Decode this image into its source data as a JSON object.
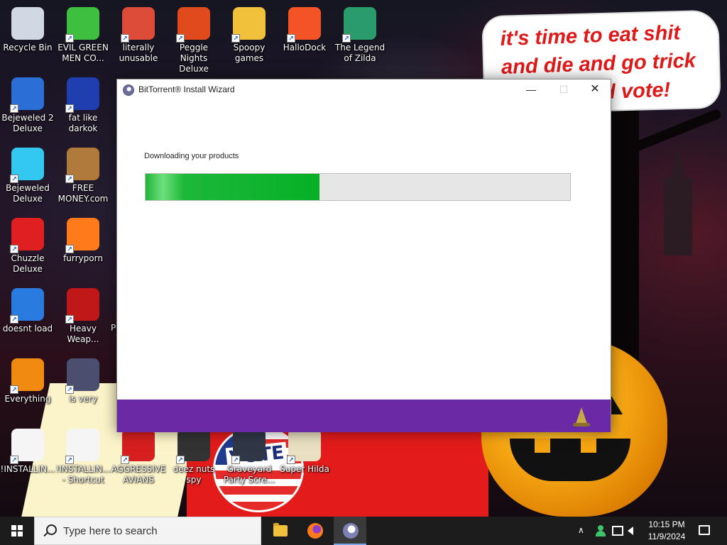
{
  "desktop": {
    "speech_bubble_text": "it's time to eat shit and die and go trick or treat and vote!",
    "badge_text": "VOTE",
    "icons": [
      {
        "label": "Recycle Bin",
        "icon": "recycle-bin-icon",
        "color": "#cfd8e3"
      },
      {
        "label": "EVIL GREEN MEN CO...",
        "icon": "evil-green-men-icon",
        "color": "#3fbf3f"
      },
      {
        "label": "literally unusable",
        "icon": "chrome-icon",
        "color": "#dd4b39"
      },
      {
        "label": "Peggle Nights Deluxe",
        "icon": "peggle-icon",
        "color": "#e04a1d"
      },
      {
        "label": "Spoopy games",
        "icon": "folder-icon",
        "color": "#f2c13b"
      },
      {
        "label": "HalloDock",
        "icon": "windows-logo-icon",
        "color": "#f35325"
      },
      {
        "label": "The Legend of Zilda",
        "icon": "zilda-icon",
        "color": "#2a9b6a"
      },
      {
        "label": "Bejeweled 2 Deluxe",
        "icon": "bejeweled-2-icon",
        "color": "#2b6fd6"
      },
      {
        "label": "fat like darkok",
        "icon": "mpl-icon",
        "color": "#1f3fb0"
      },
      {
        "label": "Bejeweled Deluxe",
        "icon": "diamond-icon",
        "color": "#32c8f0"
      },
      {
        "label": "FREE MONEY.com",
        "icon": "money-bag-icon",
        "color": "#b07a3a"
      },
      {
        "label": "Chuzzle Deluxe",
        "icon": "chuzzle-icon",
        "color": "#e02020"
      },
      {
        "label": "furryporn",
        "icon": "firefox-icon",
        "color": "#ff7a1a"
      },
      {
        "label": "doesnt load",
        "icon": "thunderbird-icon",
        "color": "#2a7be0"
      },
      {
        "label": "Heavy Weap...",
        "icon": "radiation-icon",
        "color": "#c01818"
      },
      {
        "label": "Everything",
        "icon": "magnifier-icon",
        "color": "#f08a10"
      },
      {
        "label": "is very",
        "icon": "mpl-shield-icon",
        "color": "#4a4f70"
      },
      {
        "label": "!INSTALLIN...",
        "icon": "document-icon",
        "color": "#f5f5f5"
      },
      {
        "label": "!INSTALLIN... - Shortcut",
        "icon": "document-shortcut-icon",
        "color": "#f5f5f5"
      },
      {
        "label": "AGGRESSIVE AVIANS",
        "icon": "angry-bird-icon",
        "color": "#d81f1f"
      },
      {
        "label": "deez nuts spy",
        "icon": "window-stack-icon",
        "color": "#333333"
      },
      {
        "label": "Graveyard Party Scre...",
        "icon": "graveyard-icon",
        "color": "#303848"
      },
      {
        "label": "Super Hilda",
        "icon": "hilda-icon",
        "color": "#e8e0c0"
      }
    ],
    "partial_label": "P"
  },
  "window": {
    "title": "BitTorrent® Install Wizard",
    "minimize_glyph": "—",
    "maximize_glyph": "☐",
    "close_glyph": "✕",
    "status": "Downloading your products",
    "progress": 0.41,
    "progress_color": "#06b025",
    "footer_color": "#6a2aa6"
  },
  "taskbar": {
    "search_placeholder": "Type here to search",
    "apps": [
      {
        "name": "file-explorer-icon"
      },
      {
        "name": "firefox-icon"
      },
      {
        "name": "bittorrent-icon",
        "active": true
      }
    ],
    "tray_chevron": "∧",
    "time": "10:15 PM",
    "date": "11/9/2024"
  }
}
